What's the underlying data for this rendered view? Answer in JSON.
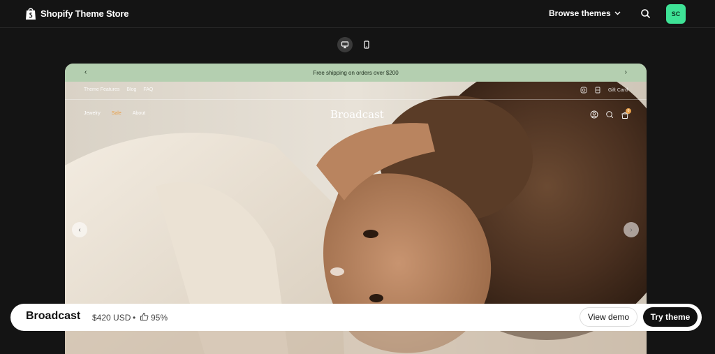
{
  "header": {
    "logo_text": "Shopify Theme Store",
    "browse_label": "Browse themes",
    "avatar_initials": "SC",
    "avatar_color": "#3ee296"
  },
  "device_toggle": {
    "options": [
      "desktop-icon",
      "mobile-icon"
    ],
    "selected": "desktop"
  },
  "preview": {
    "announcement": "Free shipping on orders over $200",
    "accent_color": "#b4cfb0",
    "top_links": [
      "Theme Features",
      "Blog",
      "FAQ"
    ],
    "gift_card": "Gift Card",
    "main_links": [
      "Jewelry",
      "Sale",
      "About"
    ],
    "brand": "Broadcast",
    "cart_count": "0"
  },
  "bottom_bar": {
    "theme_name": "Broadcast",
    "price": "$420 USD",
    "separator": "•",
    "rating": "95%",
    "view_demo_label": "View demo",
    "try_theme_label": "Try theme"
  }
}
